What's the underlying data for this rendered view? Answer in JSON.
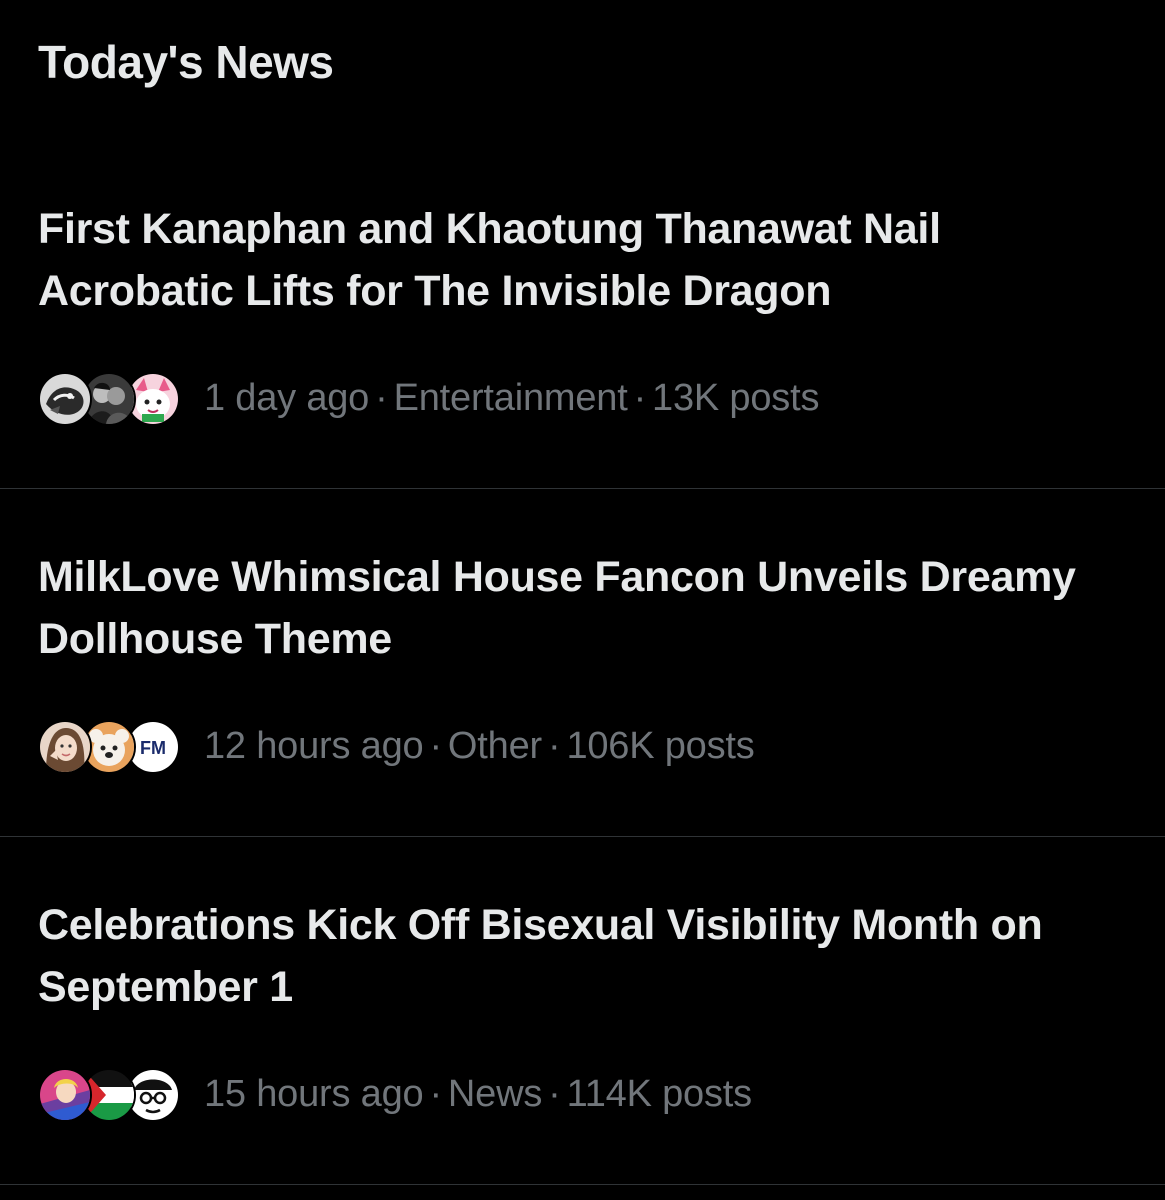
{
  "section": {
    "title": "Today's News"
  },
  "news": [
    {
      "headline": "First Kanaphan and Khaotung Thanawat Nail Acrobatic Lifts for The Invisible Dragon",
      "time": "1 day ago",
      "category": "Entertainment",
      "posts": "13K posts",
      "avatars": [
        "dragon-art-avatar",
        "couple-photo-avatar",
        "pink-cartoon-avatar"
      ]
    },
    {
      "headline": "MilkLove Whimsical House Fancon Unveils Dreamy Dollhouse Theme",
      "time": "12 hours ago",
      "category": "Other",
      "posts": "106K posts",
      "avatars": [
        "person-photo-avatar",
        "bear-cartoon-avatar",
        "fm-logo-avatar"
      ],
      "fm_logo_text": "FM"
    },
    {
      "headline": "Celebrations Kick Off Bisexual Visibility Month on September 1",
      "time": "15 hours ago",
      "category": "News",
      "posts": "114K posts",
      "avatars": [
        "colorful-illustration-avatar",
        "flag-avatar",
        "cartoon-face-avatar"
      ]
    }
  ],
  "separator": "·",
  "colors": {
    "background": "#000000",
    "primary_text": "#e7e9ea",
    "secondary_text": "#71767b",
    "divider": "#2f3336"
  }
}
